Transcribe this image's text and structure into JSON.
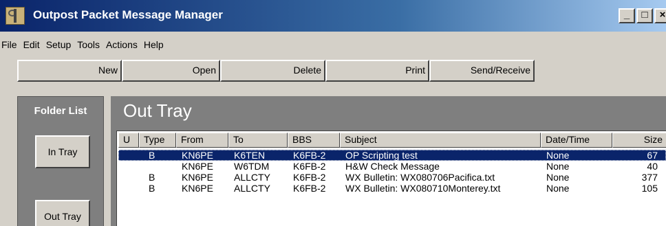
{
  "window": {
    "title": "Outpost Packet Message Manager",
    "controls": {
      "minimize": "_",
      "maximize": "□",
      "close": "×"
    }
  },
  "menu": [
    "File",
    "Edit",
    "Setup",
    "Tools",
    "Actions",
    "Help"
  ],
  "toolbar": {
    "new": "New",
    "open": "Open",
    "delete": "Delete",
    "print": "Print",
    "send_receive": "Send/Receive"
  },
  "folder_list": {
    "title": "Folder List",
    "in_tray": "In Tray",
    "out_tray": "Out Tray"
  },
  "tray": {
    "title": "Out Tray",
    "columns": [
      "U",
      "Type",
      "From",
      "To",
      "BBS",
      "Subject",
      "Date/Time",
      "Size"
    ],
    "rows": [
      {
        "u": "",
        "type": "B",
        "from": "KN6PE",
        "to": "K6TEN",
        "bbs": "K6FB-2",
        "subject": "OP Scripting test",
        "datetime": "None",
        "size": "67",
        "selected": true
      },
      {
        "u": "",
        "type": "",
        "from": "KN6PE",
        "to": "W6TDM",
        "bbs": "K6FB-2",
        "subject": "H&W Check Message",
        "datetime": "None",
        "size": "40",
        "selected": false
      },
      {
        "u": "",
        "type": "B",
        "from": "KN6PE",
        "to": "ALLCTY",
        "bbs": "K6FB-2",
        "subject": "WX Bulletin: WX080706Pacifica.txt",
        "datetime": "None",
        "size": "377",
        "selected": false
      },
      {
        "u": "",
        "type": "B",
        "from": "KN6PE",
        "to": "ALLCTY",
        "bbs": "K6FB-2",
        "subject": "WX Bulletin: WX080710Monterey.txt",
        "datetime": "None",
        "size": "105",
        "selected": false
      }
    ]
  },
  "colors": {
    "title_bar": "#0a246a",
    "selection": "#0a246a",
    "panel": "#7f7f7f",
    "face": "#d4d0c8"
  },
  "icons": {
    "app": "antenna-tower-icon"
  }
}
